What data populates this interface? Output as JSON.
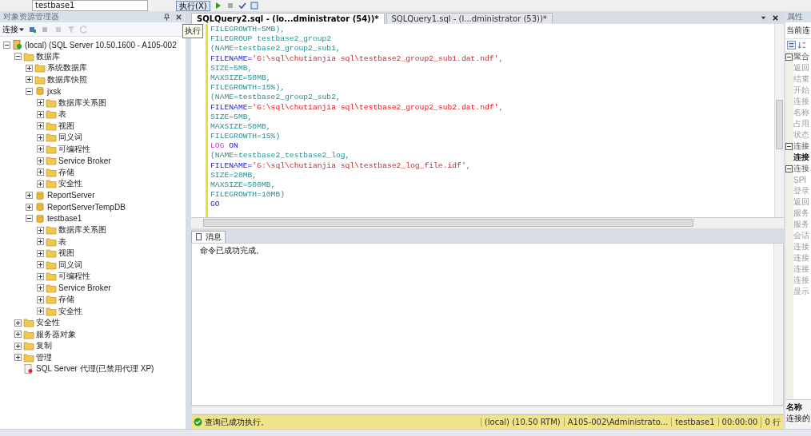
{
  "toolbar": {
    "database": "testbase1",
    "execute_button": "执行(X)",
    "tooltip": "执行"
  },
  "object_explorer": {
    "title": "对象资源管理器",
    "connect": "连接",
    "tree": [
      {
        "label": "(local) (SQL Server 10.50.1600 - A105-002",
        "kind": "server",
        "expanded": true,
        "children": [
          {
            "label": "数据库",
            "kind": "folder",
            "expanded": true,
            "children": [
              {
                "label": "系统数据库",
                "kind": "folder",
                "expanded": false
              },
              {
                "label": "数据库快照",
                "kind": "folder",
                "expanded": false
              },
              {
                "label": "jxsk",
                "kind": "database",
                "expanded": true,
                "children": [
                  {
                    "label": "数据库关系图",
                    "kind": "folder",
                    "expanded": false
                  },
                  {
                    "label": "表",
                    "kind": "folder",
                    "expanded": false
                  },
                  {
                    "label": "视图",
                    "kind": "folder",
                    "expanded": false
                  },
                  {
                    "label": "同义词",
                    "kind": "folder",
                    "expanded": false
                  },
                  {
                    "label": "可编程性",
                    "kind": "folder",
                    "expanded": false
                  },
                  {
                    "label": "Service Broker",
                    "kind": "folder",
                    "expanded": false
                  },
                  {
                    "label": "存储",
                    "kind": "folder",
                    "expanded": false
                  },
                  {
                    "label": "安全性",
                    "kind": "folder",
                    "expanded": false
                  }
                ]
              },
              {
                "label": "ReportServer",
                "kind": "database",
                "expanded": false
              },
              {
                "label": "ReportServerTempDB",
                "kind": "database",
                "expanded": false
              },
              {
                "label": "testbase1",
                "kind": "database",
                "expanded": true,
                "children": [
                  {
                    "label": "数据库关系图",
                    "kind": "folder",
                    "expanded": false
                  },
                  {
                    "label": "表",
                    "kind": "folder",
                    "expanded": false
                  },
                  {
                    "label": "视图",
                    "kind": "folder",
                    "expanded": false
                  },
                  {
                    "label": "同义词",
                    "kind": "folder",
                    "expanded": false
                  },
                  {
                    "label": "可编程性",
                    "kind": "folder",
                    "expanded": false
                  },
                  {
                    "label": "Service Broker",
                    "kind": "folder",
                    "expanded": false
                  },
                  {
                    "label": "存储",
                    "kind": "folder",
                    "expanded": false
                  },
                  {
                    "label": "安全性",
                    "kind": "folder",
                    "expanded": false
                  }
                ]
              }
            ]
          },
          {
            "label": "安全性",
            "kind": "folder",
            "expanded": false
          },
          {
            "label": "服务器对象",
            "kind": "folder",
            "expanded": false
          },
          {
            "label": "复制",
            "kind": "folder",
            "expanded": false
          },
          {
            "label": "管理",
            "kind": "folder",
            "expanded": false
          },
          {
            "label": "SQL Server 代理(已禁用代理 XP)",
            "kind": "agent"
          }
        ]
      }
    ]
  },
  "editor": {
    "tabs": [
      {
        "label": "SQLQuery2.sql - (lo...dministrator (54))*",
        "selected": true
      },
      {
        "label": "SQLQuery1.sql - (l...dministrator (53))*",
        "selected": false
      }
    ],
    "lines": [
      [
        {
          "text": "FILEGROWTH=5MB),",
          "kind": "plain"
        }
      ],
      [
        {
          "text": "FILEGROUP testbase2_group2",
          "kind": "plain"
        }
      ],
      [
        {
          "text": "(NAME=testbase2_group2_sub1,",
          "kind": "plain"
        }
      ],
      [
        {
          "text": "FILENAME=",
          "kind": "keyword"
        },
        {
          "text": "'G:\\sql\\chutianjia sql\\testbase2_group2_sub1.dat.ndf'",
          "kind": "string"
        },
        {
          "text": ",",
          "kind": "plain"
        }
      ],
      [
        {
          "text": "SIZE=5MB,",
          "kind": "plain"
        }
      ],
      [
        {
          "text": "MAXSIZE=50MB,",
          "kind": "plain"
        }
      ],
      [
        {
          "text": "FILEGROWTH=15%),",
          "kind": "plain"
        }
      ],
      [
        {
          "text": "(NAME=testbase2_group2_sub2,",
          "kind": "plain"
        }
      ],
      [
        {
          "text": "FILENAME=",
          "kind": "keyword"
        },
        {
          "text": "'G:\\sql\\chutianjia sql\\testbase2_group2_sub2.dat.ndf'",
          "kind": "string"
        },
        {
          "text": ",",
          "kind": "plain"
        }
      ],
      [
        {
          "text": "SIZE=5MB,",
          "kind": "plain"
        }
      ],
      [
        {
          "text": "MAXSIZE=50MB,",
          "kind": "plain"
        }
      ],
      [
        {
          "text": "FILEGROWTH=15%)",
          "kind": "plain"
        }
      ],
      [
        {
          "text": "LOG",
          "kind": "function"
        },
        {
          "text": " ON",
          "kind": "keyword"
        }
      ],
      [
        {
          "text": "(NAME=testbase2_testbase2_log,",
          "kind": "plain"
        }
      ],
      [
        {
          "text": "FILENAME=",
          "kind": "keyword"
        },
        {
          "text": "'G:\\sql\\chutianjia sql\\testbase2_log_file.idf'",
          "kind": "string"
        },
        {
          "text": ",",
          "kind": "plain"
        }
      ],
      [
        {
          "text": "SIZE=20MB,",
          "kind": "plain"
        }
      ],
      [
        {
          "text": "MAXSIZE=500MB,",
          "kind": "plain"
        }
      ],
      [
        {
          "text": "FILEGROWTH=10MB)",
          "kind": "plain"
        }
      ],
      [
        {
          "text": "GO",
          "kind": "keyword"
        }
      ]
    ]
  },
  "results": {
    "tab": "消息",
    "message": "命令已成功完成。"
  },
  "status_bar": {
    "message": "查询已成功执行。",
    "server": "(local) (10.50 RTM)",
    "user": "A105-002\\Administrato...",
    "database": "testbase1",
    "time": "00:00:00",
    "rows": "0 行"
  },
  "properties": {
    "title": "属性",
    "object": "当前连",
    "rows": [
      {
        "label": "聚合",
        "kind": "group",
        "expanded": true
      },
      {
        "label": "返回",
        "kind": "item",
        "selected": false
      },
      {
        "label": "结束",
        "kind": "item",
        "selected": false
      },
      {
        "label": "开始",
        "kind": "item",
        "selected": false
      },
      {
        "label": "连接",
        "kind": "item",
        "selected": false
      },
      {
        "label": "名称",
        "kind": "item",
        "selected": false
      },
      {
        "label": "占用",
        "kind": "item",
        "selected": false
      },
      {
        "label": "状态",
        "kind": "item",
        "selected": false
      },
      {
        "label": "连接",
        "kind": "group",
        "expanded": true
      },
      {
        "label": "连接",
        "kind": "item",
        "selected": true
      },
      {
        "label": "连接",
        "kind": "group",
        "expanded": true
      },
      {
        "label": "SPI",
        "kind": "item",
        "selected": false
      },
      {
        "label": "登录",
        "kind": "item",
        "selected": false
      },
      {
        "label": "返回",
        "kind": "item",
        "selected": false
      },
      {
        "label": "服务",
        "kind": "item",
        "selected": false
      },
      {
        "label": "服务",
        "kind": "item",
        "selected": false
      },
      {
        "label": "会话",
        "kind": "item",
        "selected": false
      },
      {
        "label": "连接",
        "kind": "item",
        "selected": false
      },
      {
        "label": "连接",
        "kind": "item",
        "selected": false
      },
      {
        "label": "连接",
        "kind": "item",
        "selected": false
      },
      {
        "label": "连接",
        "kind": "item",
        "selected": false
      },
      {
        "label": "显示",
        "kind": "item",
        "selected": false
      }
    ],
    "description_title": "名称",
    "description": "连接的"
  }
}
